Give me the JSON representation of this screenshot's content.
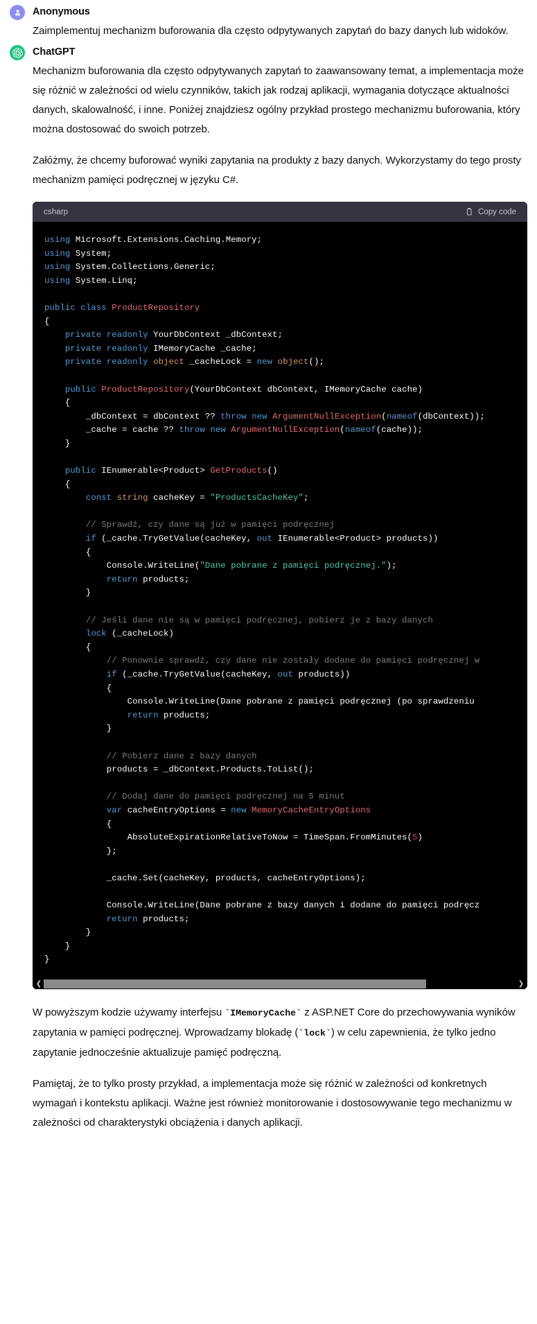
{
  "conversation": {
    "user_message": {
      "author": "Anonymous",
      "avatar_icon": "user-person-icon",
      "text": "Zaimplementuj mechanizm buforowania dla często odpytywanych zapytań do bazy danych lub widoków."
    },
    "assistant_message": {
      "author": "ChatGPT",
      "avatar_icon": "openai-logo-icon",
      "paragraph_1": "Mechanizm buforowania dla często odpytywanych zapytań to zaawansowany temat, a implementacja może się różnić w zależności od wielu czynników, takich jak rodzaj aplikacji, wymagania dotyczące aktualności danych, skalowalność, i inne. Poniżej znajdziesz ogólny przykład prostego mechanizmu buforowania, który można dostosować do swoich potrzeb.",
      "paragraph_2": "Załóżmy, że chcemy buforować wyniki zapytania na produkty z bazy danych. Wykorzystamy do tego prosty mechanizm pamięci podręcznej w języku C#.",
      "closing_1_a": "W powyższym kodzie używamy interfejsu ",
      "closing_1_code1": "`IMemoryCache`",
      "closing_1_b": " z ASP.NET Core do przechowywania wyników zapytania w pamięci podręcznej. Wprowadzamy blokadę (",
      "closing_1_code2": "`lock`",
      "closing_1_c": ") w celu zapewnienia, że tylko jedno zapytanie jednocześnie aktualizuje pamięć podręczną.",
      "closing_2": "Pamiętaj, że to tylko prosty przykład, a implementacja może się różnić w zależności od konkretnych wymagań i kontekstu aplikacji. Ważne jest również monitorowanie i dostosowywanie tego mechanizmu w zależności od charakterystyki obciążenia i danych aplikacji."
    },
    "code_block": {
      "language": "csharp",
      "copy_label": "Copy code",
      "copy_icon": "clipboard-icon",
      "scroll_left_icon": "chevron-left-icon",
      "scroll_right_icon": "chevron-right-icon",
      "code_lines": [
        "using Microsoft.Extensions.Caching.Memory;",
        "using System;",
        "using System.Collections.Generic;",
        "using System.Linq;",
        "",
        "public class ProductRepository",
        "{",
        "    private readonly YourDbContext _dbContext;",
        "    private readonly IMemoryCache _cache;",
        "    private readonly object _cacheLock = new object();",
        "",
        "    public ProductRepository(YourDbContext dbContext, IMemoryCache cache)",
        "    {",
        "        _dbContext = dbContext ?? throw new ArgumentNullException(nameof(dbContext));",
        "        _cache = cache ?? throw new ArgumentNullException(nameof(cache));",
        "    }",
        "",
        "    public IEnumerable<Product> GetProducts()",
        "    {",
        "        const string cacheKey = \"ProductsCacheKey\";",
        "",
        "        // Sprawdź, czy dane są już w pamięci podręcznej",
        "        if (_cache.TryGetValue(cacheKey, out IEnumerable<Product> products))",
        "        {",
        "            Console.WriteLine(\"Dane pobrane z pamięci podręcznej.\");",
        "            return products;",
        "        }",
        "",
        "        // Jeśli dane nie są w pamięci podręcznej, pobierz je z bazy danych",
        "        lock (_cacheLock)",
        "        {",
        "            // Ponownie sprawdź, czy dane nie zostały dodane do pamięci podręcznej w",
        "            if (_cache.TryGetValue(cacheKey, out products))",
        "            {",
        "                Console.WriteLine(\"Dane pobrane z pamięci podręcznej (po sprawdzeniu",
        "                return products;",
        "            }",
        "",
        "            // Pobierz dane z bazy danych",
        "            products = _dbContext.Products.ToList();",
        "",
        "            // Dodaj dane do pamięci podręcznej na 5 minut",
        "            var cacheEntryOptions = new MemoryCacheEntryOptions",
        "            {",
        "                AbsoluteExpirationRelativeToNow = TimeSpan.FromMinutes(5)",
        "            };",
        "",
        "            _cache.Set(cacheKey, products, cacheEntryOptions);",
        "",
        "            Console.WriteLine(\"Dane pobrane z bazy danych i dodane do pamięci podręcz",
        "            return products;",
        "        }",
        "    }",
        "}"
      ]
    }
  },
  "colors": {
    "code_header_bg": "#343541",
    "code_bg": "#000000",
    "assistant_accent": "#19c37d",
    "user_accent": "#8e8ef0"
  }
}
